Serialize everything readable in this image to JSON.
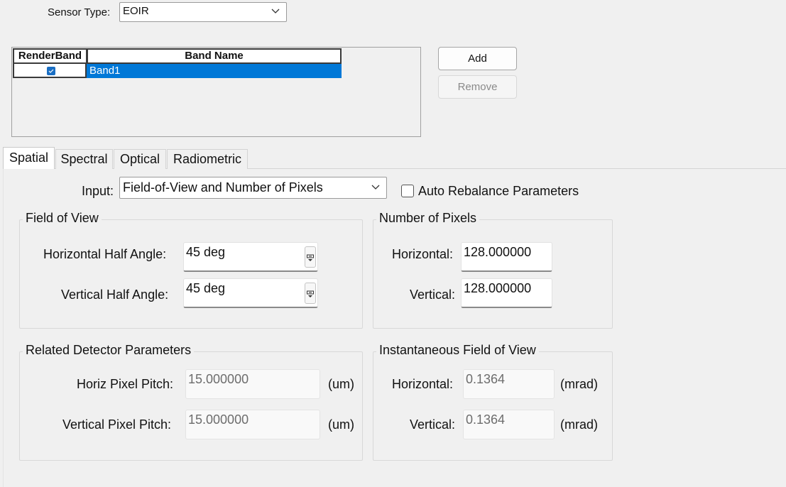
{
  "sensor": {
    "label": "Sensor Type:",
    "value": "EOIR"
  },
  "bands": {
    "columns": [
      "RenderBand",
      "Band Name"
    ],
    "rows": [
      {
        "render": true,
        "name": "Band1"
      }
    ]
  },
  "buttons": {
    "add": "Add",
    "remove": "Remove"
  },
  "tabs": [
    "Spatial",
    "Spectral",
    "Optical",
    "Radiometric"
  ],
  "spatial": {
    "input_label": "Input:",
    "input_value": "Field-of-View and Number of Pixels",
    "auto_rebalance_label": "Auto Rebalance Parameters",
    "auto_rebalance_checked": false,
    "field_of_view": {
      "title": "Field of View",
      "horizontal_label": "Horizontal Half Angle:",
      "horizontal_value": "45 deg",
      "vertical_label": "Vertical Half Angle:",
      "vertical_value": "45 deg"
    },
    "number_of_pixels": {
      "title": "Number of Pixels",
      "horizontal_label": "Horizontal:",
      "horizontal_value": "128.000000",
      "vertical_label": "Vertical:",
      "vertical_value": "128.000000"
    },
    "detector": {
      "title": "Related Detector Parameters",
      "horiz_label": "Horiz Pixel Pitch:",
      "horiz_value": "15.000000",
      "horiz_unit": "(um)",
      "vert_label": "Vertical Pixel Pitch:",
      "vert_value": "15.000000",
      "vert_unit": "(um)"
    },
    "ifov": {
      "title": "Instantaneous Field of View",
      "horizontal_label": "Horizontal:",
      "horizontal_value": "0.1364",
      "horizontal_unit": "(mrad)",
      "vertical_label": "Vertical:",
      "vertical_value": "0.1364",
      "vertical_unit": "(mrad)"
    }
  },
  "colors": {
    "selection": "#0078d7",
    "checkbox": "#1a6fc4",
    "background": "#f0f0f0"
  }
}
